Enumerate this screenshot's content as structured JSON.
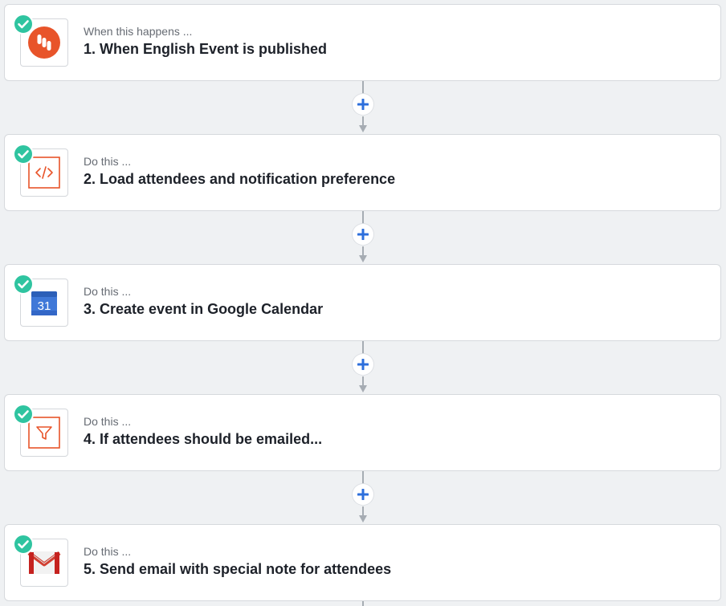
{
  "steps": [
    {
      "kicker": "When this happens ...",
      "title": "1. When English Event is published",
      "icon": "app-trigger-icon"
    },
    {
      "kicker": "Do this ...",
      "title": "2. Load attendees and notification preference",
      "icon": "code-icon"
    },
    {
      "kicker": "Do this ...",
      "title": "3. Create event in Google Calendar",
      "icon": "google-calendar-icon"
    },
    {
      "kicker": "Do this ...",
      "title": "4. If attendees should be emailed...",
      "icon": "filter-icon"
    },
    {
      "kicker": "Do this ...",
      "title": "5. Send email with special note for attendees",
      "icon": "gmail-icon"
    }
  ],
  "calendar_day": "31",
  "colors": {
    "check": "#2fc4a0",
    "accent_orange": "#e8542a",
    "add_blue": "#2d6fdc",
    "connector": "#a6acb3"
  }
}
